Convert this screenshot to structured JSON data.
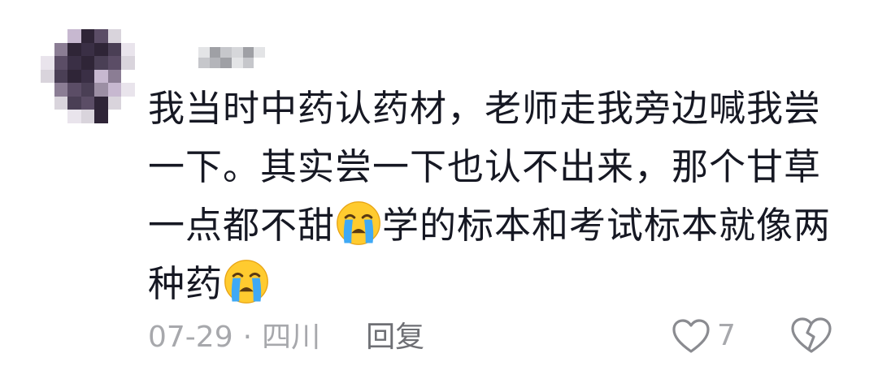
{
  "comment": {
    "text_lines": [
      "我当时中药认药材，老师走我旁边喊我尝",
      "一下。其实尝一下也认不出来，那个甘草",
      "一点都不甜",
      "学的标本和考试标本就像两",
      "种药"
    ],
    "emoji": "loudly-crying-face",
    "date": "07-29",
    "separator": "·",
    "location": "四川",
    "reply_label": "回复",
    "like_count": "7",
    "liked": false
  },
  "colors": {
    "text": "#161823",
    "meta": "#a7a8ac",
    "reply": "#6e6f74",
    "icon": "#8a8b90"
  }
}
